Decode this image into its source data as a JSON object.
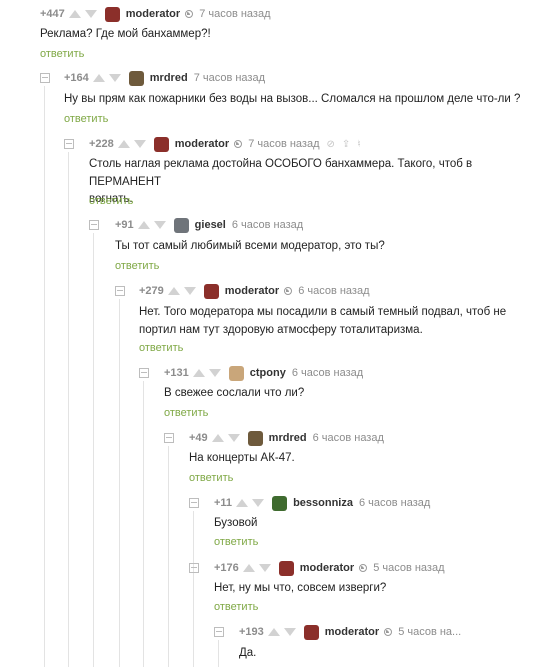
{
  "reply_label": "ответить",
  "comments": [
    {
      "rating": "+447",
      "author": "moderator",
      "moderator": true,
      "time": "7 часов назад",
      "text": "Реклама? Где мой банхаммер?!",
      "avatar_color": "#8b2f2a"
    },
    {
      "rating": "+164",
      "author": "mrdred",
      "moderator": false,
      "time": "7 часов назад",
      "text": "Ну вы прям как пожарники без воды на вызов... Сломался на прошлом деле что-ли ?",
      "avatar_color": "#6e5a3c"
    },
    {
      "rating": "+228",
      "author": "moderator",
      "moderator": true,
      "time": "7 часов назад",
      "text": "Столь наглая реклама достойна ОСОБОГО банхаммера. Такого, чтоб в ПЕРМАНЕНТ\nвогнать.",
      "avatar_color": "#8b2f2a",
      "tools": [
        "link-icon",
        "save-icon",
        "bookmark-icon"
      ]
    },
    {
      "rating": "+91",
      "author": "giesel",
      "moderator": false,
      "time": "6 часов назад",
      "text": "Ты тот самый любимый всеми модератор, это ты?",
      "avatar_color": "#6f747a"
    },
    {
      "rating": "+279",
      "author": "moderator",
      "moderator": true,
      "time": "6 часов назад",
      "text": "Нет. Того модератора мы посадили в самый темный подвал, чтоб не\nпортил нам тут здоровую атмосферу тоталитаризма.",
      "avatar_color": "#8b2f2a"
    },
    {
      "rating": "+131",
      "author": "ctpony",
      "moderator": false,
      "time": "6 часов назад",
      "text": "В свежее сослали что ли?",
      "avatar_color": "#c9a67a"
    },
    {
      "rating": "+49",
      "author": "mrdred",
      "moderator": false,
      "time": "6 часов назад",
      "text": "На концерты АК-47.",
      "avatar_color": "#6e5a3c"
    },
    {
      "rating": "+11",
      "author": "bessonniza",
      "moderator": false,
      "time": "6 часов назад",
      "text": "Бузовой",
      "avatar_color": "#3f6b2f"
    },
    {
      "rating": "+176",
      "author": "moderator",
      "moderator": true,
      "time": "5 часов назад",
      "text": "Нет, ну мы что, совсем изверги?",
      "avatar_color": "#8b2f2a"
    },
    {
      "rating": "+193",
      "author": "moderator",
      "moderator": true,
      "time": "5 часов на...",
      "text": "Да.",
      "avatar_color": "#8b2f2a"
    }
  ]
}
